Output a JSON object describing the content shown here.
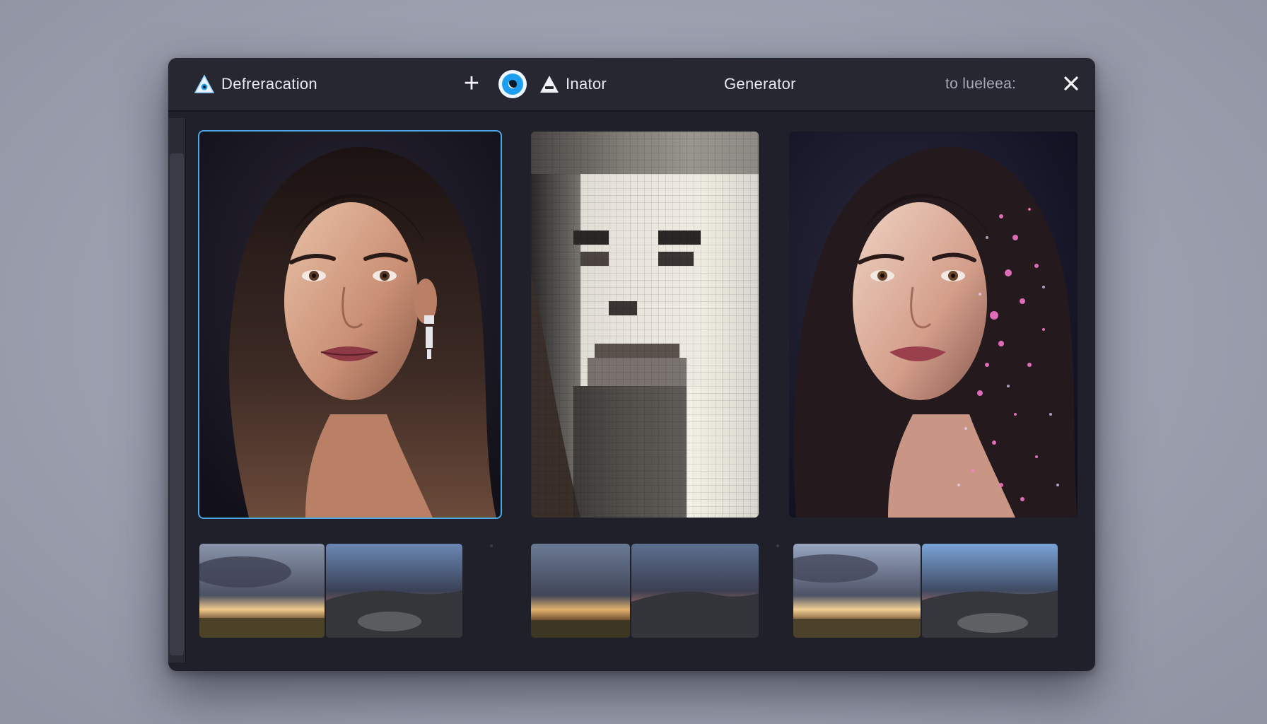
{
  "titlebar": {
    "app_name": "Defreracation",
    "tool_name": "Inator",
    "center_title": "Generator",
    "right_label": "to lueleea:"
  },
  "icons": {
    "app": "triangle-logo-icon",
    "add": "plus-icon",
    "eye": "eye-icon",
    "tool": "triangle-icon",
    "close": "close-icon"
  },
  "panels": [
    {
      "name": "original-portrait",
      "selected": true
    },
    {
      "name": "pixelated-portrait",
      "selected": false
    },
    {
      "name": "particle-portrait",
      "selected": false
    }
  ],
  "colors": {
    "accent": "#4fa7e8",
    "window_bg": "#1f2029",
    "titlebar_bg": "#262731"
  }
}
